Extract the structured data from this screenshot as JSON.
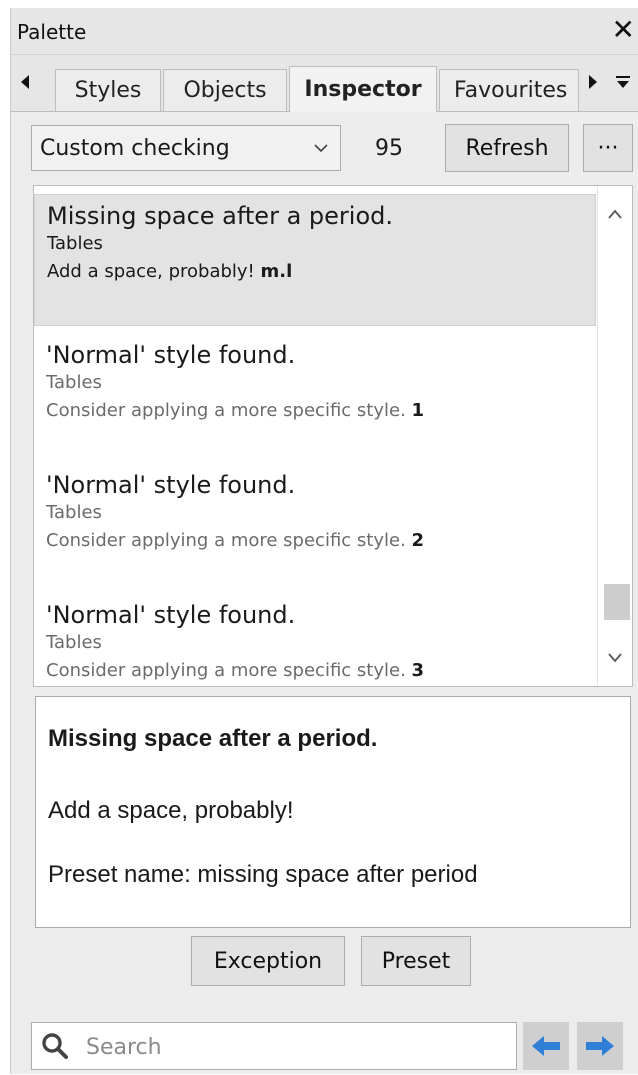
{
  "window": {
    "title": "Palette",
    "close_glyph": "✕"
  },
  "tabs": [
    {
      "label": "Styles"
    },
    {
      "label": "Objects"
    },
    {
      "label": "Inspector",
      "active": true
    },
    {
      "label": "Favourites"
    }
  ],
  "toolbar": {
    "dropdown_value": "Custom checking",
    "count": "95",
    "refresh_label": "Refresh",
    "more_label": "···"
  },
  "list": {
    "items": [
      {
        "title": "Missing space after a period.",
        "category": "Tables",
        "hint": "Add a space, probably!",
        "ref": "m.l",
        "selected": true
      },
      {
        "title": "'Normal' style found.",
        "category": "Tables",
        "hint": "Consider applying a more specific style.",
        "ref": "1"
      },
      {
        "title": "'Normal' style found.",
        "category": "Tables",
        "hint": "Consider applying a more specific style.",
        "ref": "2"
      },
      {
        "title": "'Normal' style found.",
        "category": "Tables",
        "hint": "Consider applying a more specific style.",
        "ref": "3"
      }
    ]
  },
  "detail": {
    "title": "Missing space after a period.",
    "message": "Add a space, probably!",
    "preset": "Preset name: missing space after period"
  },
  "actions": {
    "exception_label": "Exception",
    "preset_label": "Preset"
  },
  "search": {
    "placeholder": "Search",
    "value": ""
  },
  "colors": {
    "accent_blue": "#2f7fd6",
    "panel_bg": "#ececec",
    "selection_bg": "#e3e3e3"
  },
  "icons": {
    "tab_left": "left-arrow-icon",
    "tab_right": "right-arrow-icon",
    "tab_menu": "menu-down-icon",
    "dropdown": "chevron-down-icon",
    "search": "search-icon",
    "back": "back-arrow-icon",
    "forward": "forward-arrow-icon"
  }
}
